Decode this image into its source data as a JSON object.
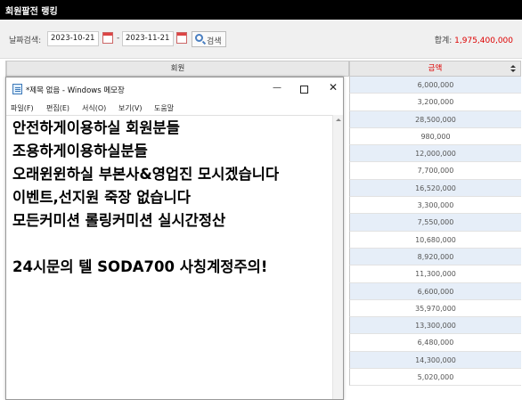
{
  "page": {
    "title": "회원팔전 랭킹"
  },
  "filter": {
    "label": "날짜검색:",
    "date_from": "2023-10-21",
    "date_to": "2023-11-21",
    "separator": "-",
    "search_label": "검색",
    "total_label": "합계:",
    "total_value": "1,975,400,000"
  },
  "table": {
    "col_member": "회원",
    "col_amount": "금액",
    "amounts": [
      "6,000,000",
      "3,200,000",
      "28,500,000",
      "980,000",
      "12,000,000",
      "7,700,000",
      "16,520,000",
      "3,300,000",
      "7,550,000",
      "10,680,000",
      "8,920,000",
      "11,300,000",
      "6,600,000",
      "35,970,000",
      "13,300,000",
      "6,480,000",
      "14,300,000",
      "5,020,000"
    ]
  },
  "notepad": {
    "title": "*제목 없음 - Windows 메모장",
    "min_glyph": "—",
    "close_glyph": "✕",
    "menu": [
      "파일(F)",
      "편집(E)",
      "서식(O)",
      "보기(V)",
      "도움말"
    ],
    "lines": [
      "안전하게이용하실 회원분들",
      "조용하게이용하실분들",
      "오래윈윈하실 부본사&영업진 모시겠습니다",
      "이벤트,선지원 죽장 없습니다",
      "모든커미션 롤링커미션 실시간정산",
      "24시문의 텔 SODA700 사칭계정주의!"
    ]
  },
  "colors": {
    "accent_red": "#d00000",
    "row_blue": "#e6eef8",
    "titlebar": "#000000"
  }
}
